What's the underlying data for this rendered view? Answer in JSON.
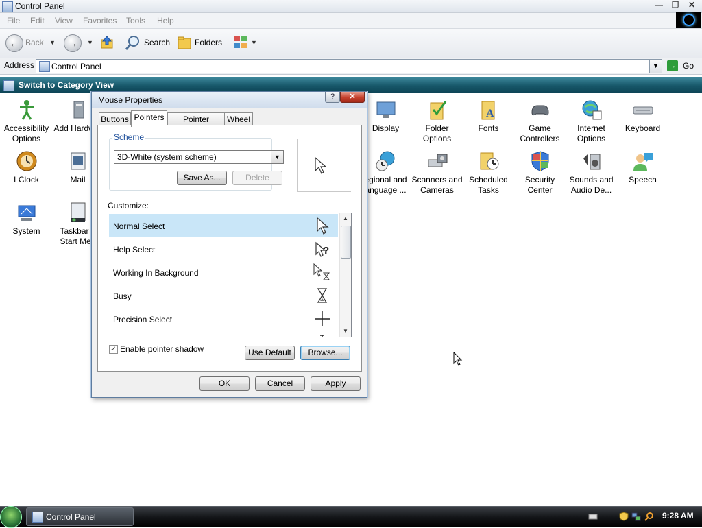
{
  "window": {
    "title": "Control Panel"
  },
  "menu": [
    "File",
    "Edit",
    "View",
    "Favorites",
    "Tools",
    "Help"
  ],
  "toolbar": {
    "back_label": "Back",
    "search_label": "Search",
    "folders_label": "Folders"
  },
  "address": {
    "label": "Address",
    "value": "Control Panel",
    "go_label": "Go"
  },
  "category_bar": {
    "label": "Switch to Category View"
  },
  "items": [
    {
      "label": "Accessibility Options",
      "icon": "accessibility-icon"
    },
    {
      "label": "Add Hardwar",
      "icon": "add-hardware-icon"
    },
    {
      "label": "Display",
      "icon": "display-icon"
    },
    {
      "label": "Folder Options",
      "icon": "folder-options-icon"
    },
    {
      "label": "Fonts",
      "icon": "fonts-icon"
    },
    {
      "label": "Game Controllers",
      "icon": "game-controller-icon"
    },
    {
      "label": "Internet Options",
      "icon": "internet-options-icon"
    },
    {
      "label": "Keyboard",
      "icon": "keyboard-icon"
    },
    {
      "label": "LClock",
      "icon": "clock-icon"
    },
    {
      "label": "Mail",
      "icon": "mail-icon"
    },
    {
      "label": "egional and anguage ...",
      "icon": "regional-icon"
    },
    {
      "label": "Scanners and Cameras",
      "icon": "scanner-icon"
    },
    {
      "label": "Scheduled Tasks",
      "icon": "scheduled-tasks-icon"
    },
    {
      "label": "Security Center",
      "icon": "shield-icon"
    },
    {
      "label": "Sounds and Audio De...",
      "icon": "speaker-icon"
    },
    {
      "label": "Speech",
      "icon": "speech-icon"
    },
    {
      "label": "System",
      "icon": "system-icon"
    },
    {
      "label": "Taskbar a Start Men",
      "icon": "taskbar-icon"
    }
  ],
  "dialog": {
    "title": "Mouse Properties",
    "tabs": [
      "Buttons",
      "Pointers",
      "Pointer Options",
      "Wheel"
    ],
    "selected_tab": "Pointers",
    "scheme_label": "Scheme",
    "scheme_value": "3D-White (system scheme)",
    "save_as_label": "Save As...",
    "delete_label": "Delete",
    "customize_label": "Customize:",
    "pointers": [
      {
        "name": "Normal Select",
        "icon": "arrow-cursor-icon",
        "selected": true
      },
      {
        "name": "Help Select",
        "icon": "help-cursor-icon",
        "selected": false
      },
      {
        "name": "Working In Background",
        "icon": "working-cursor-icon",
        "selected": false
      },
      {
        "name": "Busy",
        "icon": "hourglass-cursor-icon",
        "selected": false
      },
      {
        "name": "Precision Select",
        "icon": "crosshair-cursor-icon",
        "selected": false
      },
      {
        "name": "",
        "icon": "text-cursor-icon",
        "selected": false
      }
    ],
    "shadow_label": "Enable pointer shadow",
    "shadow_checked": true,
    "use_default_label": "Use Default",
    "browse_label": "Browse...",
    "ok_label": "OK",
    "cancel_label": "Cancel",
    "apply_label": "Apply"
  },
  "taskbar": {
    "task_label": "Control Panel",
    "clock": "9:28 AM"
  }
}
